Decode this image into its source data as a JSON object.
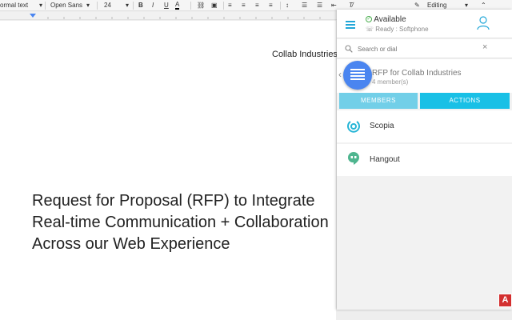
{
  "toolbar": {
    "style": "ormal text",
    "font": "Open Sans",
    "size": "24",
    "bold": "B",
    "italic": "I",
    "underline": "U",
    "text_color": "A",
    "mode": "Editing"
  },
  "document": {
    "header": "Collab Industries R",
    "lines": [
      "Request for Proposal (RFP) to Integrate",
      "Real-time Communication + Collaboration",
      "Across our Web Experience"
    ]
  },
  "panel": {
    "status": "Available",
    "status_sub": "Ready : Softphone",
    "search": {
      "placeholder": "Search or dial"
    },
    "conversation": {
      "title": "RFP for Collab Industries",
      "members": "4 member(s)"
    },
    "tabs": {
      "members": "MEMBERS",
      "actions": "ACTIONS"
    },
    "actions": [
      {
        "label": "Scopia",
        "icon": "scopia-icon"
      },
      {
        "label": "Hangout",
        "icon": "hangout-icon"
      }
    ]
  },
  "corner_badge": "A",
  "colors": {
    "accent": "#19c0e6",
    "accent_light": "#72cfe8",
    "badge": "#4a85f0",
    "brand_red": "#d32f2f"
  }
}
